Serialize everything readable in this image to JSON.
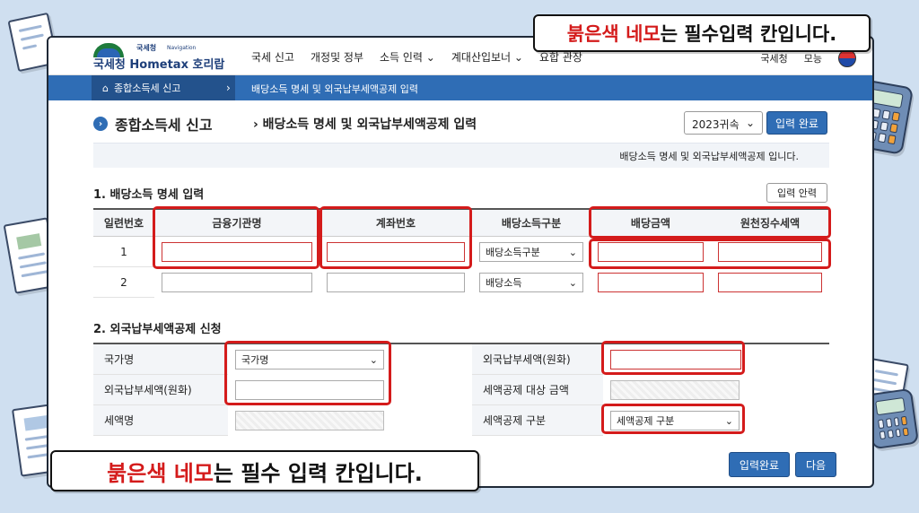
{
  "captions": {
    "top_red": "붉은색 네모",
    "top_rest": "는 필수입력 칸입니다.",
    "bottom_red": "붉은색 네모",
    "bottom_rest": "는 필수 입력 칸입니다."
  },
  "logo": {
    "small": "국세청",
    "nav": "Navigation",
    "brand": "국세청 Hometax 호리랍"
  },
  "menu": [
    "국세 신고",
    "개정및 정부",
    "소득 인력 ⌄",
    "계대산입보너 ⌄",
    "요합 관장"
  ],
  "header_right": [
    "국세청",
    "모능"
  ],
  "breadcrumb": {
    "home": "종합소득세 신고",
    "current": "배당소득 명세 및 외국납부세액공제 입력"
  },
  "title": "종합소득세 신고",
  "subtitle": "배당소득 명세 및 외국납부세액공제 입력",
  "year_select": "2023귀속",
  "submit_top": "입력 완료",
  "notice": "배당소득 명세 및 외국납부세액공제 입니다.",
  "section1": {
    "title": "1. 배당소득 명세 입력",
    "reset": "입력 안력",
    "headers": [
      "일련번호",
      "금융기관명",
      "계좌번호",
      "배당소득구분",
      "배당금액",
      "원천징수세액"
    ],
    "rows": [
      {
        "no": "1",
        "type": "배당소득구분"
      },
      {
        "no": "2",
        "type": "배당소득"
      }
    ]
  },
  "section2": {
    "title": "2. 외국납부세액공제 신청",
    "left": [
      {
        "label": "국가명",
        "select": "국가명"
      },
      {
        "label": "외국납부세액(원화)"
      },
      {
        "label": "세액명"
      }
    ],
    "right": [
      {
        "label": "외국납부세액(원화)"
      },
      {
        "label": "세액공제 대상 금액"
      },
      {
        "label": "세액공제 구분",
        "select": "세액공제 구분"
      }
    ]
  },
  "buttons": {
    "complete": "입력완료",
    "next": "다음"
  },
  "colors": {
    "accent": "#2f6db5",
    "required": "#d41b1b"
  }
}
